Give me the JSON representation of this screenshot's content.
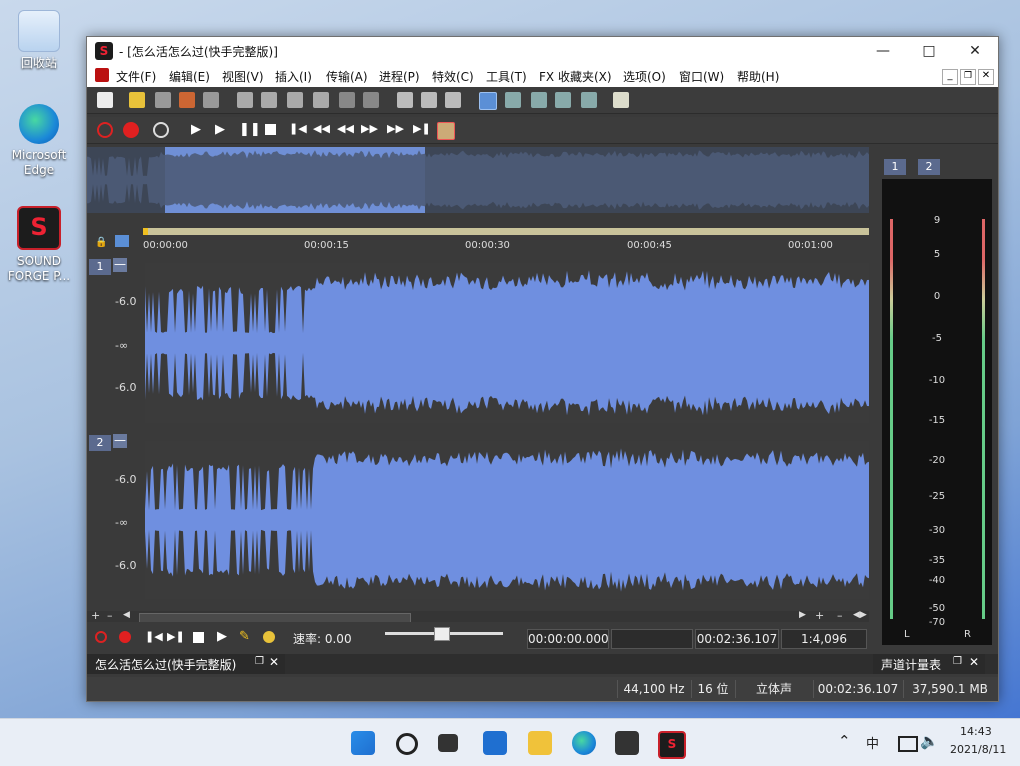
{
  "desktop": {
    "icons": [
      {
        "label": "回收站"
      },
      {
        "label": "Microsoft Edge"
      },
      {
        "label": "SOUND FORGE P..."
      }
    ]
  },
  "window": {
    "title": "- [怎么活怎么过(快手完整版)]",
    "menu": [
      "文件(F)",
      "编辑(E)",
      "视图(V)",
      "插入(I)",
      "传输(A)",
      "进程(P)",
      "特效(C)",
      "工具(T)",
      "FX 收藏夹(X)",
      "选项(O)",
      "窗口(W)",
      "帮助(H)"
    ]
  },
  "ruler": {
    "ticks": [
      "00:00:00",
      "00:00:15",
      "00:00:30",
      "00:00:45",
      "00:01:00"
    ]
  },
  "tracks": [
    {
      "id": "1",
      "labels": [
        "-6.0",
        "-∞",
        "-6.0"
      ]
    },
    {
      "id": "2",
      "labels": [
        "-6.0",
        "-∞",
        "-6.0"
      ]
    }
  ],
  "meter": {
    "tabs": [
      "1",
      "2"
    ],
    "scale": [
      "9",
      "5",
      "0",
      "-5",
      "-10",
      "-15",
      "-20",
      "-25",
      "-30",
      "-35",
      "-40",
      "-50",
      "-70"
    ],
    "channels": [
      "L",
      "R"
    ],
    "title": "声道计量表"
  },
  "transport": {
    "rate_label": "速率: 0.00",
    "pos_start": "00:00:00.000",
    "pos_end": "00:02:36.107",
    "zoom": "1:4,096"
  },
  "doc": {
    "name": "怎么活怎么过(快手完整版)"
  },
  "status": {
    "rate": "44,100 Hz",
    "bits": "16 位",
    "channels": "立体声",
    "length": "00:02:36.107",
    "size": "37,590.1 MB"
  },
  "clock": {
    "time": "14:43",
    "date": "2021/8/11",
    "ime": "中"
  }
}
